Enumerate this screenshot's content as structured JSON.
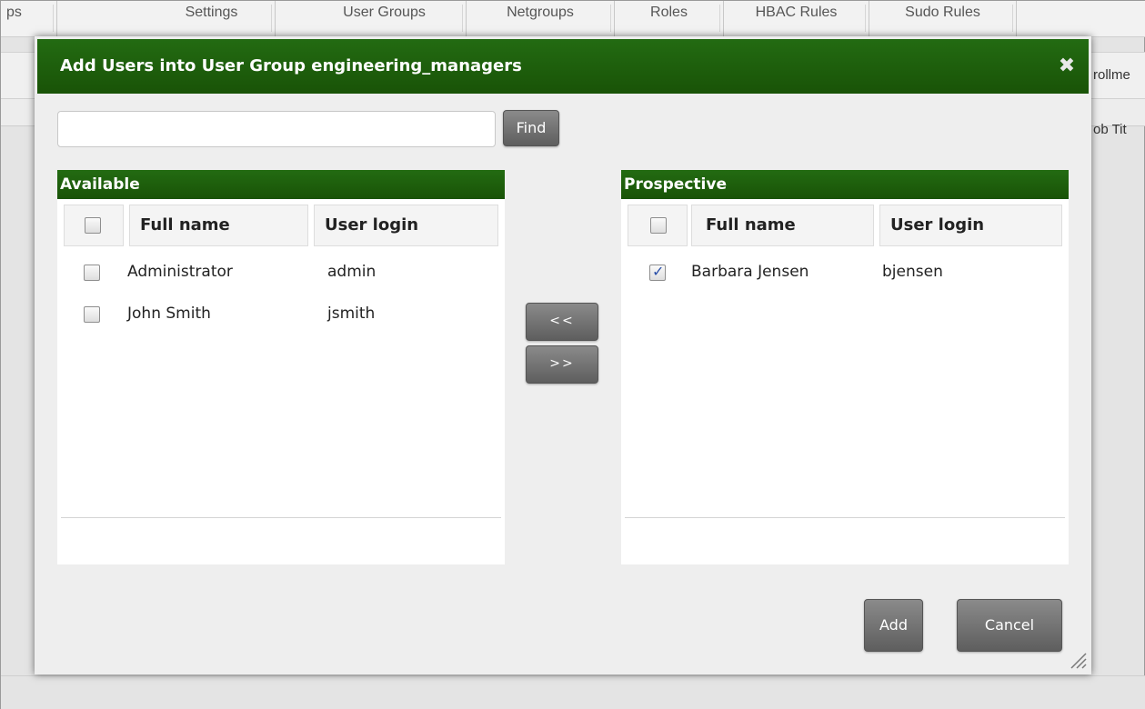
{
  "background": {
    "tabs": [
      "ps",
      "Settings",
      "User Groups",
      "Netgroups",
      "Roles",
      "HBAC Rules",
      "Sudo Rules"
    ],
    "right_text_1": "rollme",
    "right_text_2": "ob Tit"
  },
  "dialog": {
    "title": "Add Users into User Group engineering_managers",
    "close_icon": "close-icon",
    "search": {
      "value": "",
      "placeholder": ""
    },
    "find_label": "Find",
    "available": {
      "header": "Available",
      "columns": [
        "Full name",
        "User login"
      ],
      "rows": [
        {
          "full_name": "Administrator",
          "user_login": "admin",
          "checked": false
        },
        {
          "full_name": "John Smith",
          "user_login": "jsmith",
          "checked": false
        }
      ]
    },
    "prospective": {
      "header": "Prospective",
      "columns": [
        "Full name",
        "User login"
      ],
      "rows": [
        {
          "full_name": "Barbara Jensen",
          "user_login": "bjensen",
          "checked": true
        }
      ]
    },
    "move_left_label": "<<",
    "move_right_label": ">>",
    "add_label": "Add",
    "cancel_label": "Cancel"
  },
  "colors": {
    "header_green": "#1b5e0b",
    "button_gray": "#6e6e6e",
    "checkmark_blue": "#2a4fa8"
  }
}
